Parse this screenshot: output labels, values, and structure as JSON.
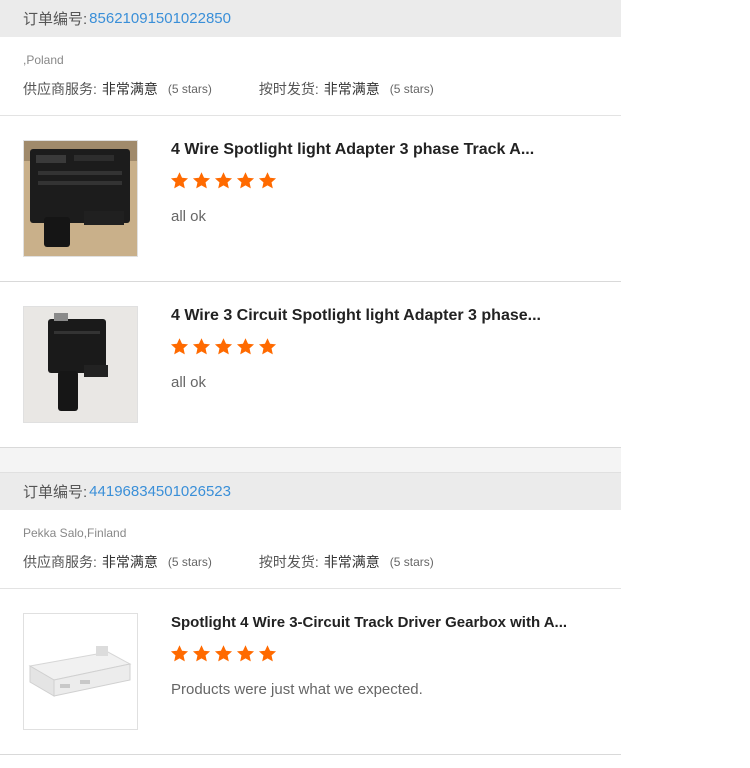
{
  "orders": [
    {
      "order_label": "订单编号:",
      "order_number": "85621091501022850",
      "buyer": ",Poland",
      "supplier_service_label": "供应商服务:",
      "supplier_service_value": "非常满意",
      "supplier_service_stars": "(5 stars)",
      "delivery_label": "按时发货:",
      "delivery_value": "非常满意",
      "delivery_stars": "(5 stars)",
      "products": [
        {
          "title": "4 Wire Spotlight light Adapter 3 phase Track A...",
          "rating": 5,
          "comment": "all ok",
          "image_icon": "black-track-adapter-image"
        },
        {
          "title": "4 Wire 3 Circuit Spotlight light Adapter 3 phase...",
          "rating": 5,
          "comment": "all ok",
          "image_icon": "black-track-adapter-image"
        }
      ]
    },
    {
      "order_label": "订单编号:",
      "order_number": "44196834501026523",
      "buyer": "Pekka Salo,Finland",
      "supplier_service_label": "供应商服务:",
      "supplier_service_value": "非常满意",
      "supplier_service_stars": "(5 stars)",
      "delivery_label": "按时发货:",
      "delivery_value": "非常满意",
      "delivery_stars": "(5 stars)",
      "products": [
        {
          "title": "Spotlight 4 Wire 3-Circuit Track Driver Gearbox with A...",
          "rating": 5,
          "comment": "Products were just what we expected.",
          "image_icon": "white-track-driver-image"
        }
      ]
    }
  ],
  "colors": {
    "star": "#ff6a00",
    "order_number": "#3a8fd8",
    "header_bg": "#ebebeb"
  }
}
